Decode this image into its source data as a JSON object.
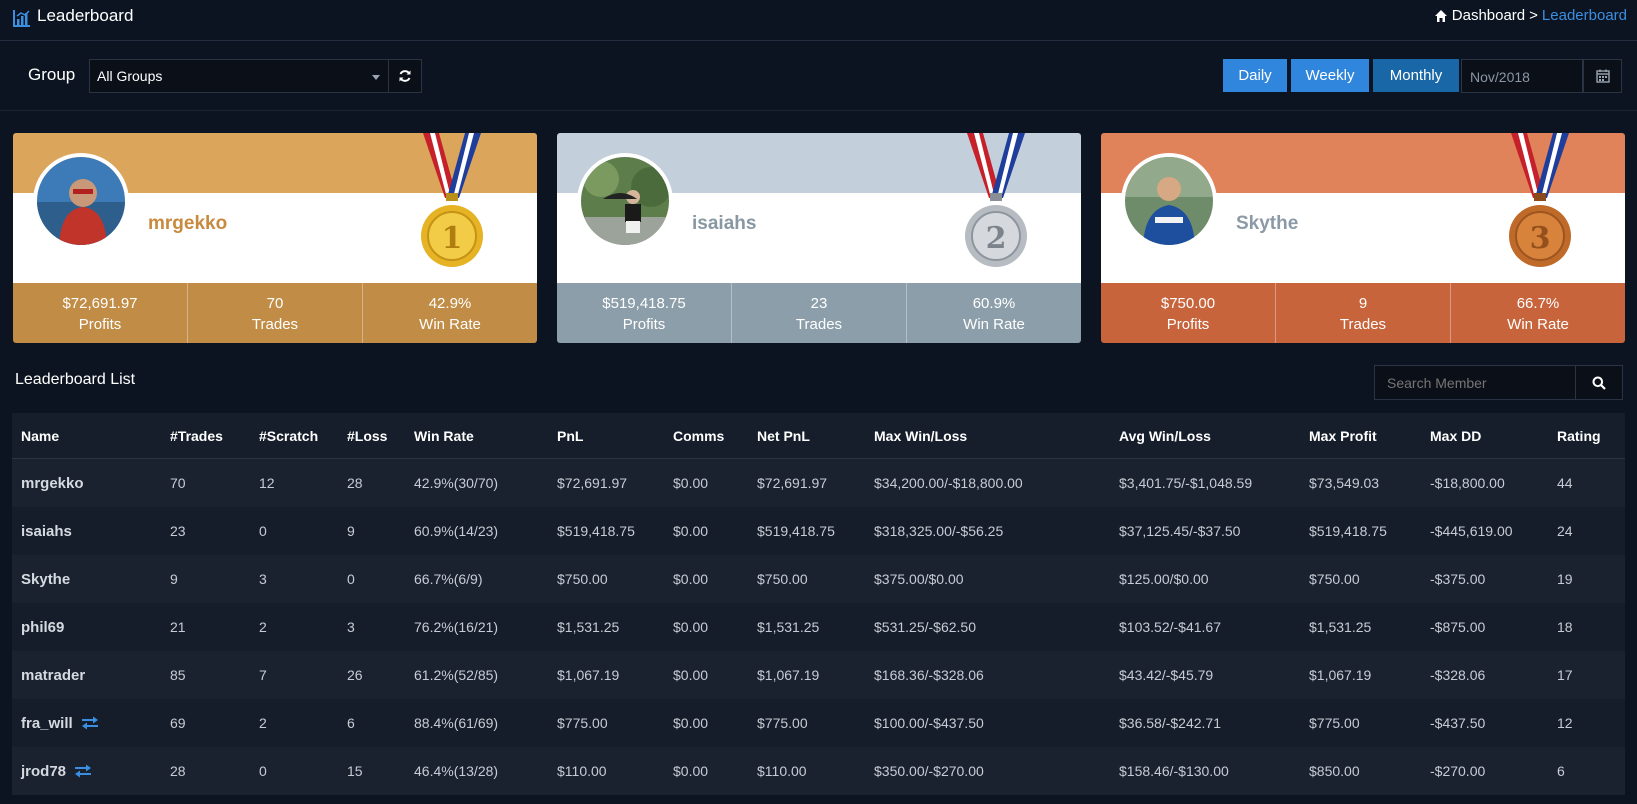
{
  "header": {
    "title": "Leaderboard",
    "breadcrumb": [
      "Dashboard",
      "Leaderboard"
    ],
    "breadcrumb_sep": ">"
  },
  "filters": {
    "group_label": "Group",
    "group_value": "All Groups",
    "periods": [
      "Daily",
      "Weekly",
      "Monthly"
    ],
    "active_period": "Monthly",
    "date_value": "Nov/2018"
  },
  "podium": [
    {
      "rank": "1",
      "name": "mrgekko",
      "profits": "$72,691.97",
      "trades": "70",
      "win_rate": "42.9%",
      "profits_label": "Profits",
      "trades_label": "Trades",
      "win_rate_label": "Win Rate"
    },
    {
      "rank": "2",
      "name": "isaiahs",
      "profits": "$519,418.75",
      "trades": "23",
      "win_rate": "60.9%",
      "profits_label": "Profits",
      "trades_label": "Trades",
      "win_rate_label": "Win Rate"
    },
    {
      "rank": "3",
      "name": "Skythe",
      "profits": "$750.00",
      "trades": "9",
      "win_rate": "66.7%",
      "profits_label": "Profits",
      "trades_label": "Trades",
      "win_rate_label": "Win Rate"
    }
  ],
  "list": {
    "title": "Leaderboard List",
    "search_placeholder": "Search Member",
    "columns": [
      "Name",
      "#Trades",
      "#Scratch",
      "#Loss",
      "Win Rate",
      "PnL",
      "Comms",
      "Net PnL",
      "Max Win/Loss",
      "Avg Win/Loss",
      "Max Profit",
      "Max DD",
      "Rating"
    ],
    "rows": [
      [
        "mrgekko",
        "70",
        "12",
        "28",
        "42.9%(30/70)",
        "$72,691.97",
        "$0.00",
        "$72,691.97",
        "$34,200.00/-$18,800.00",
        "$3,401.75/-$1,048.59",
        "$73,549.03",
        "-$18,800.00",
        "44"
      ],
      [
        "isaiahs",
        "23",
        "0",
        "9",
        "60.9%(14/23)",
        "$519,418.75",
        "$0.00",
        "$519,418.75",
        "$318,325.00/-$56.25",
        "$37,125.45/-$37.50",
        "$519,418.75",
        "-$445,619.00",
        "24"
      ],
      [
        "Skythe",
        "9",
        "3",
        "0",
        "66.7%(6/9)",
        "$750.00",
        "$0.00",
        "$750.00",
        "$375.00/$0.00",
        "$125.00/$0.00",
        "$750.00",
        "-$375.00",
        "19"
      ],
      [
        "phil69",
        "21",
        "2",
        "3",
        "76.2%(16/21)",
        "$1,531.25",
        "$0.00",
        "$1,531.25",
        "$531.25/-$62.50",
        "$103.52/-$41.67",
        "$1,531.25",
        "-$875.00",
        "18"
      ],
      [
        "matrader",
        "85",
        "7",
        "26",
        "61.2%(52/85)",
        "$1,067.19",
        "$0.00",
        "$1,067.19",
        "$168.36/-$328.06",
        "$43.42/-$45.79",
        "$1,067.19",
        "-$328.06",
        "17"
      ],
      [
        "fra_will",
        "69",
        "2",
        "6",
        "88.4%(61/69)",
        "$775.00",
        "$0.00",
        "$775.00",
        "$100.00/-$437.50",
        "$36.58/-$242.71",
        "$775.00",
        "-$437.50",
        "12"
      ],
      [
        "jrod78",
        "28",
        "0",
        "15",
        "46.4%(13/28)",
        "$110.00",
        "$0.00",
        "$110.00",
        "$350.00/-$270.00",
        "$158.46/-$130.00",
        "$850.00",
        "-$270.00",
        "6"
      ]
    ],
    "swap_rows": [
      5,
      6
    ]
  }
}
